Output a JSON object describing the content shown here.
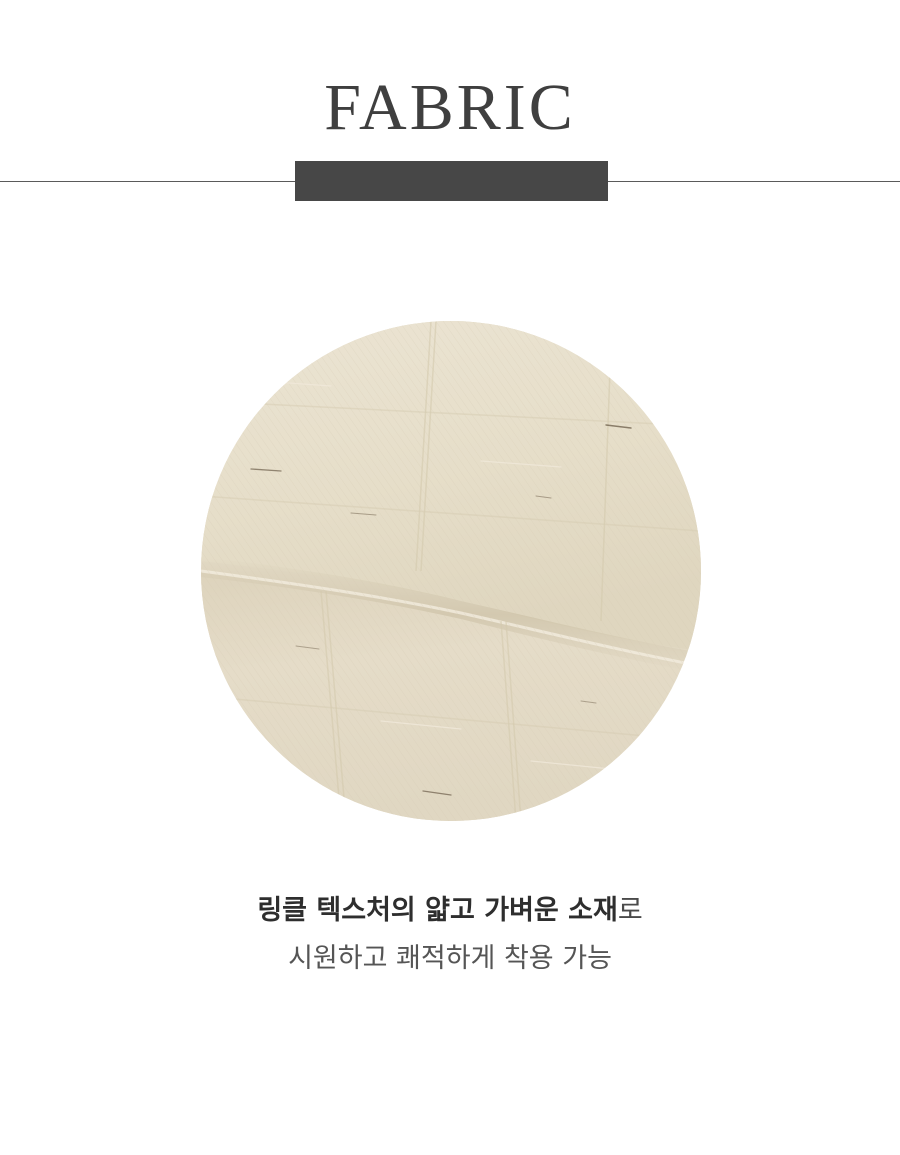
{
  "section": {
    "title": "FABRIC"
  },
  "swatch": {
    "image": "beige-linen-fabric-swatch",
    "base_color": "#e3dac6",
    "highlight_color": "#ede6d6",
    "shadow_color": "#cfc5ae",
    "slub_color": "#6b5c48"
  },
  "caption": {
    "line1_bold": "링클 텍스처의 얇고 가벼운 소재",
    "line1_regular": "로",
    "line2": "시원하고 쾌적하게 착용 가능"
  },
  "colors": {
    "title": "#3f3f3f",
    "divider_bar": "#474747",
    "divider_line": "#5a5a5a",
    "text": "#333333"
  }
}
